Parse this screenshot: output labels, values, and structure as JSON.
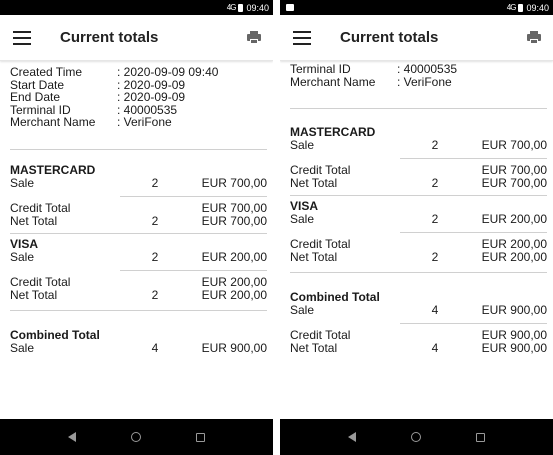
{
  "status": {
    "signal": "4G",
    "time": "09:40"
  },
  "appbar": {
    "title": "Current totals",
    "menu_icon": "hamburger-icon",
    "print_icon": "printer-icon"
  },
  "info": {
    "created_label": "Created Time",
    "created_value": ": 2020-09-09 09:40",
    "start_label": "Start Date",
    "start_value": ": 2020-09-09",
    "end_label": "End Date",
    "end_value": ": 2020-09-09",
    "terminal_label": "Terminal ID",
    "terminal_value": ": 40000535",
    "merchant_label": "Merchant Name",
    "merchant_value": ": VeriFone"
  },
  "mastercard": {
    "name": "MASTERCARD",
    "sale_label": "Sale",
    "sale_count": "2",
    "sale_amount": "EUR 700,00",
    "credit_label": "Credit Total",
    "credit_amount": "EUR 700,00",
    "net_label": "Net Total",
    "net_count": "2",
    "net_amount": "EUR 700,00"
  },
  "visa": {
    "name": "VISA",
    "sale_label": "Sale",
    "sale_count": "2",
    "sale_amount": "EUR 200,00",
    "credit_label": "Credit Total",
    "credit_amount": "EUR 200,00",
    "net_label": "Net Total",
    "net_count": "2",
    "net_amount": "EUR 200,00"
  },
  "combined": {
    "name": "Combined Total",
    "sale_label": "Sale",
    "sale_count": "4",
    "sale_amount": "EUR 900,00",
    "credit_label": "Credit Total",
    "credit_amount": "EUR 900,00",
    "net_label": "Net Total",
    "net_count": "4",
    "net_amount": "EUR 900,00"
  },
  "nav": {
    "back_icon": "back-triangle-icon",
    "home_icon": "home-circle-icon",
    "recent_icon": "recents-square-icon"
  }
}
